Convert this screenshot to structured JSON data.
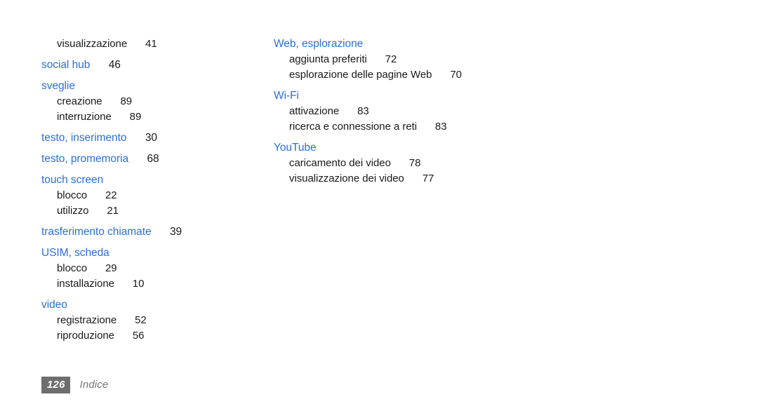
{
  "document": {
    "type": "index",
    "footer": {
      "page_number": "126",
      "section_label": "Indice",
      "badge_color": "#6e6e6e",
      "label_color": "#757575"
    },
    "colors": {
      "entry_heading": "#2b6fd8",
      "entry_text": "#1a1a1a",
      "background": "#ffffff"
    }
  },
  "columns": {
    "left": {
      "groups": [
        {
          "heading": null,
          "subentries": [
            {
              "label": "visualizzazione",
              "page": "41"
            }
          ]
        },
        {
          "heading": {
            "label": "social hub",
            "page": "46"
          },
          "subentries": []
        },
        {
          "heading": {
            "label": "sveglie",
            "page": ""
          },
          "subentries": [
            {
              "label": "creazione",
              "page": "89"
            },
            {
              "label": "interruzione",
              "page": "89"
            }
          ]
        },
        {
          "heading": {
            "label": "testo, inserimento",
            "page": "30"
          },
          "subentries": []
        },
        {
          "heading": {
            "label": "testo, promemoria",
            "page": "68"
          },
          "subentries": []
        },
        {
          "heading": {
            "label": "touch screen",
            "page": ""
          },
          "subentries": [
            {
              "label": "blocco",
              "page": "22"
            },
            {
              "label": "utilizzo",
              "page": "21"
            }
          ]
        },
        {
          "heading": {
            "label": "trasferimento chiamate",
            "page": "39"
          },
          "subentries": []
        },
        {
          "heading": {
            "label": "USIM, scheda",
            "page": ""
          },
          "subentries": [
            {
              "label": "blocco",
              "page": "29"
            },
            {
              "label": "installazione",
              "page": "10"
            }
          ]
        },
        {
          "heading": {
            "label": "video",
            "page": ""
          },
          "subentries": [
            {
              "label": "registrazione",
              "page": "52"
            },
            {
              "label": "riproduzione",
              "page": "56"
            }
          ]
        }
      ]
    },
    "right": {
      "groups": [
        {
          "heading": {
            "label": "Web, esplorazione",
            "page": ""
          },
          "subentries": [
            {
              "label": "aggiunta preferiti",
              "page": "72"
            },
            {
              "label": "esplorazione delle pagine Web",
              "page": "70"
            }
          ]
        },
        {
          "heading": {
            "label": "Wi-Fi",
            "page": ""
          },
          "subentries": [
            {
              "label": "attivazione",
              "page": "83"
            },
            {
              "label": "ricerca e connessione a reti",
              "page": "83"
            }
          ]
        },
        {
          "heading": {
            "label": "YouTube",
            "page": ""
          },
          "subentries": [
            {
              "label": "caricamento dei video",
              "page": "78"
            },
            {
              "label": "visualizzazione dei video",
              "page": "77"
            }
          ]
        }
      ]
    }
  }
}
